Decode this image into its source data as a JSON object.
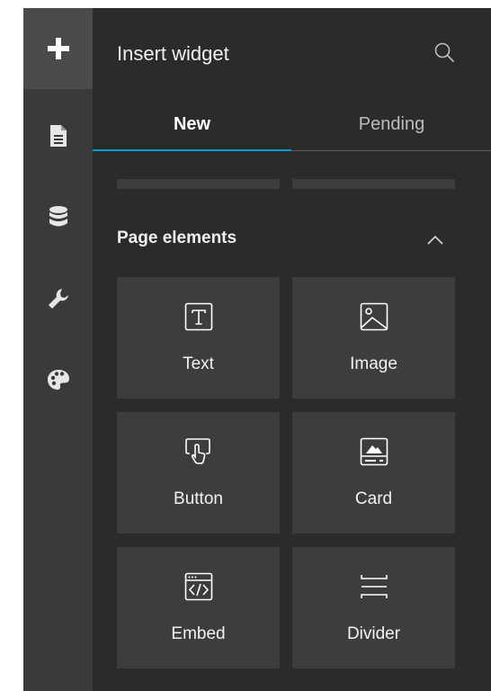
{
  "rail": {
    "items": [
      {
        "icon": "plus-icon",
        "active": true
      },
      {
        "icon": "document-icon",
        "active": false
      },
      {
        "icon": "database-icon",
        "active": false
      },
      {
        "icon": "wrench-icon",
        "active": false
      },
      {
        "icon": "palette-icon",
        "active": false
      }
    ]
  },
  "panel": {
    "title": "Insert widget",
    "search_icon": "search-icon"
  },
  "tabs": [
    {
      "label": "New",
      "active": true
    },
    {
      "label": "Pending",
      "active": false
    }
  ],
  "section": {
    "title": "Page elements",
    "expanded": true,
    "widgets": [
      {
        "label": "Text",
        "icon": "text-icon"
      },
      {
        "label": "Image",
        "icon": "image-icon"
      },
      {
        "label": "Button",
        "icon": "button-icon"
      },
      {
        "label": "Card",
        "icon": "card-icon"
      },
      {
        "label": "Embed",
        "icon": "embed-icon"
      },
      {
        "label": "Divider",
        "icon": "divider-icon"
      }
    ]
  },
  "colors": {
    "accent": "#00a0d2",
    "background": "#2b2b2b",
    "rail": "#3a3a3a",
    "tile": "#3d3d3d"
  }
}
